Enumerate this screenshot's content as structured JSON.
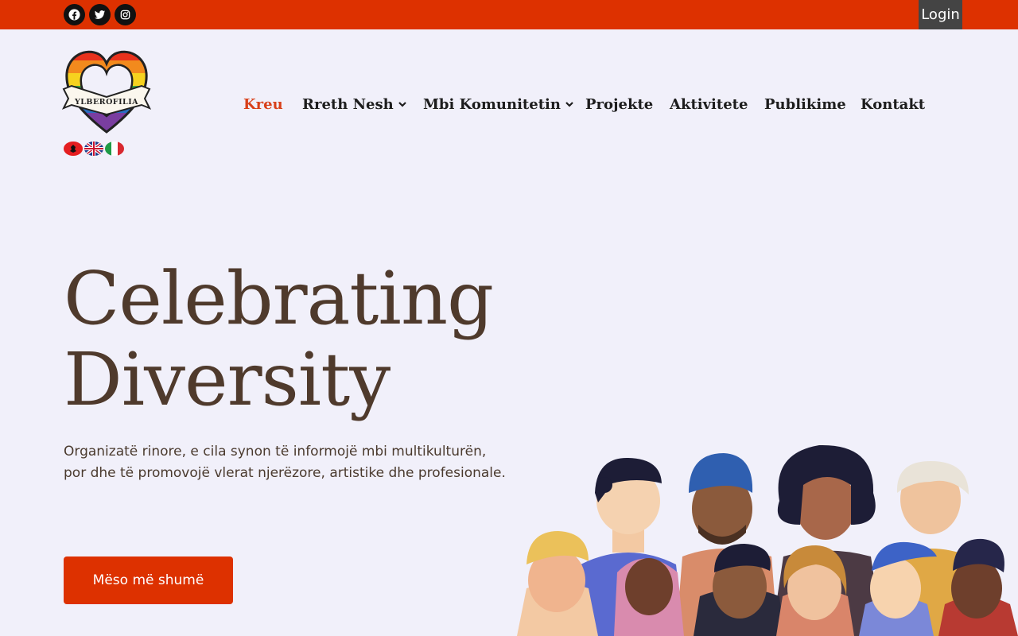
{
  "topbar": {
    "social": [
      "facebook-icon",
      "twitter-icon",
      "instagram-icon"
    ],
    "login_label": "Login"
  },
  "logo": {
    "banner_text": "YLBEROFILIA"
  },
  "languages": [
    "Shqip",
    "English",
    "Italiano"
  ],
  "nav": {
    "items": [
      {
        "label": "Kreu",
        "active": true,
        "has_dropdown": false
      },
      {
        "label": "Rreth Nesh",
        "active": false,
        "has_dropdown": true
      },
      {
        "label": "Mbi Komunitetin",
        "active": false,
        "has_dropdown": true
      },
      {
        "label": "Projekte",
        "active": false,
        "has_dropdown": false
      },
      {
        "label": "Aktivitete",
        "active": false,
        "has_dropdown": false
      },
      {
        "label": "Publikime",
        "active": false,
        "has_dropdown": false
      },
      {
        "label": "Kontakt",
        "active": false,
        "has_dropdown": false
      }
    ]
  },
  "hero": {
    "title_line1": "Celebrating",
    "title_line2": "Diversity",
    "subtitle": "Organizatë rinore, e cila synon të informojë mbi multikulturën, por dhe të promovojë vlerat njerëzore, artistike dhe profesionale.",
    "cta_label": "Mëso më shumë",
    "illustration": "diverse-people-illustration"
  },
  "colors": {
    "accent": "#dd3100",
    "background": "#f1f0fa",
    "heading": "#4f3a2c",
    "nav_active": "#d8401a"
  }
}
